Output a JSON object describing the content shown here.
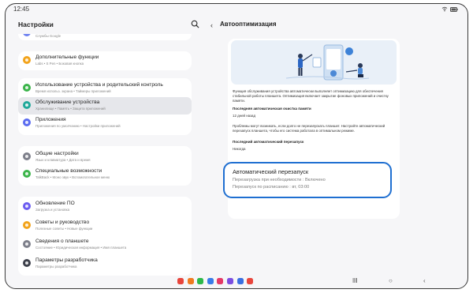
{
  "status_bar": {
    "time": "12:45"
  },
  "left": {
    "title": "Настройки",
    "groups": [
      {
        "items": [
          {
            "title": "",
            "subtitle": "Службы Google",
            "color": "#6b7ff0"
          }
        ]
      },
      {
        "items": [
          {
            "title": "Дополнительные функции",
            "subtitle": "Labs  •  S Pen  •  Боковая кнопка",
            "color": "#f2a31b"
          }
        ]
      },
      {
        "items": [
          {
            "title": "Использование устройства и родительский контроль",
            "subtitle": "Время использ. экрана  •  Таймеры приложений",
            "color": "#3bb44a"
          },
          {
            "title": "Обслуживание устройства",
            "subtitle": "Хранилище  •  Память  •  Защита приложений",
            "color": "#1fa89a",
            "selected": true
          },
          {
            "title": "Приложения",
            "subtitle": "Приложения по умолчанию  •  Настройки приложений",
            "color": "#5b6cf0"
          }
        ]
      },
      {
        "items": [
          {
            "title": "Общие настройки",
            "subtitle": "Язык и клавиатура  •  Дата и время",
            "color": "#7d7f8a"
          },
          {
            "title": "Специальные возможности",
            "subtitle": "TalkBack  •  Моно звук  •  Вспомогательное меню",
            "color": "#3bb44a"
          }
        ]
      },
      {
        "items": [
          {
            "title": "Обновление ПО",
            "subtitle": "Загрузка и установка",
            "color": "#6b5cf0"
          },
          {
            "title": "Советы и руководство",
            "subtitle": "Полезные советы  •  Новые функции",
            "color": "#f2a31b"
          },
          {
            "title": "Сведения о планшете",
            "subtitle": "Состояние  •  Юридическая информация  •  Имя планшета",
            "color": "#7d7f8a"
          },
          {
            "title": "Параметры разработчика",
            "subtitle": "Параметры разработчика",
            "color": "#3c3f4a"
          }
        ]
      }
    ]
  },
  "right": {
    "title": "Автооптимизация",
    "description": "Функция обслуживания устройства автоматически выполняет оптимизацию для обеспечения стабильной работы планшета. Оптимизация включает закрытие фоновых приложений и очистку памяти.",
    "last_clean_label": "Последняя автоматическая очистка памяти",
    "last_clean_value": "12 дней назад",
    "restart_note": "Проблемы могут возникать, если долго не перезапускать планшет. Настройте автоматический перезапуск планшета, чтобы его система работала в оптимальном режиме.",
    "last_restart_label": "Последний автоматический перезапуск",
    "last_restart_value": "Никогда",
    "auto_restart": {
      "title": "Автоматический перезапуск",
      "line1": "Перезагрузка при необходимости : Включено",
      "line2": "Перезапуск по расписанию : вт, 03:00"
    }
  },
  "dock_apps": [
    {
      "name": "app-1",
      "color": "#e8453c"
    },
    {
      "name": "app-2",
      "color": "#f07a20"
    },
    {
      "name": "app-3",
      "color": "#2db84a"
    },
    {
      "name": "app-4",
      "color": "#3a7be8"
    },
    {
      "name": "app-5",
      "color": "#e53966"
    },
    {
      "name": "app-6",
      "color": "#7b4ee0"
    },
    {
      "name": "app-7",
      "color": "#3a6fe0"
    },
    {
      "name": "app-8",
      "color": "#e8453c"
    }
  ],
  "colors": {
    "accent": "#1f6fd1",
    "selected_bg": "#e6e7eb",
    "hero_bg": "#e9f0f8"
  }
}
